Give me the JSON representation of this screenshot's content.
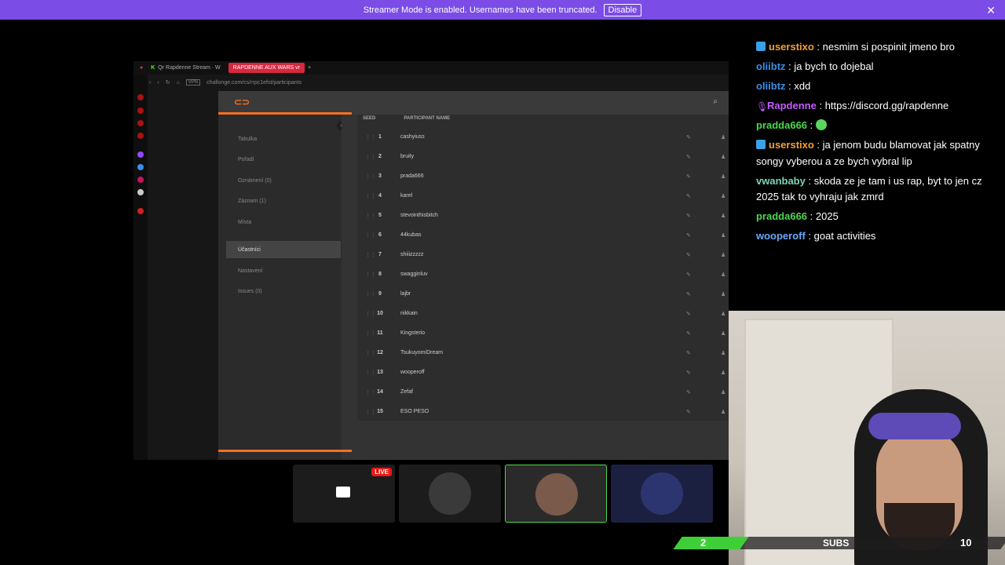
{
  "banner": {
    "text": "Streamer Mode is enabled. Usernames have been truncated.",
    "button": "Disable"
  },
  "browser": {
    "tabs": [
      "Qr Rapdenne Stream · W",
      "RAPDENNE AUX WARS vr"
    ],
    "url": "challonge.com/cs/rrpc1efst/participants",
    "vpn": "VPN"
  },
  "app": {
    "nav": [
      "Tabulka",
      "Pořadí",
      "Oznámení (0)",
      "Záznam (1)",
      "Místa",
      "Účastníci",
      "Nastavení",
      "Issues (0)"
    ],
    "active_nav": "Účastníci",
    "columns": {
      "seed": "SEED",
      "name": "PARTICIPANT NAME"
    },
    "participants": [
      {
        "seed": "1",
        "name": "cashyiuss"
      },
      {
        "seed": "2",
        "name": "bruity"
      },
      {
        "seed": "3",
        "name": "prada666"
      },
      {
        "seed": "4",
        "name": "karel"
      },
      {
        "seed": "5",
        "name": "stevointhisbitch"
      },
      {
        "seed": "6",
        "name": "44kubas"
      },
      {
        "seed": "7",
        "name": "shiiizzzzz"
      },
      {
        "seed": "8",
        "name": "swagginluv"
      },
      {
        "seed": "9",
        "name": "lajbr"
      },
      {
        "seed": "10",
        "name": "nikkain"
      },
      {
        "seed": "11",
        "name": "Kingsterio"
      },
      {
        "seed": "12",
        "name": "TsukuyomiDream"
      },
      {
        "seed": "13",
        "name": "wooperoff"
      },
      {
        "seed": "14",
        "name": "Zefaf"
      },
      {
        "seed": "15",
        "name": "ESO PESO"
      }
    ]
  },
  "chat": [
    {
      "user": "userstixo",
      "color": "#f59e3a",
      "badge": "blue",
      "text": "nesmim si pospinit jmeno bro"
    },
    {
      "user": "oliibtz",
      "color": "#3a8fe8",
      "badge": "",
      "text": "ja bych to dojebal"
    },
    {
      "user": "oliibtz",
      "color": "#3a8fe8",
      "badge": "",
      "text": "xdd"
    },
    {
      "user": "Rapdenne",
      "color": "#c45cff",
      "badge": "mic",
      "text": "https://discord.gg/rapdenne"
    },
    {
      "user": "pradda666",
      "color": "#4ed84e",
      "badge": "",
      "text": ""
    },
    {
      "user": "userstixo",
      "color": "#f59e3a",
      "badge": "blue",
      "text": "ja jenom budu blamovat jak spatny songy vyberou a ze bych vybral lip"
    },
    {
      "user": "vwanbaby",
      "color": "#7fd3b4",
      "badge": "",
      "text": "skoda ze je tam i us rap, byt to jen cz 2025 tak to vyhraju jak zmrd"
    },
    {
      "user": "pradda666",
      "color": "#4ed84e",
      "badge": "",
      "text": "2025"
    },
    {
      "user": "wooperoff",
      "color": "#6aa6ff",
      "badge": "",
      "text": "goat activities"
    }
  ],
  "subs": {
    "current": "2",
    "label": "SUBS",
    "goal": "10"
  },
  "tiles": {
    "live_label": "LIVE"
  }
}
